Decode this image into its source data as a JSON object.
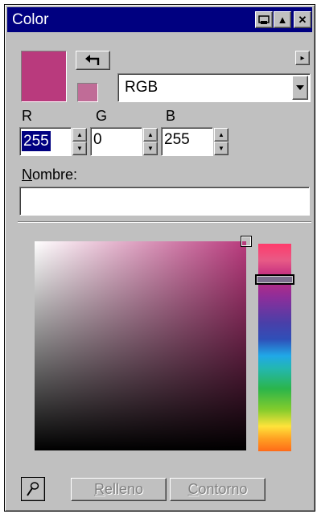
{
  "window": {
    "title": "Color",
    "btn_dock": "⊟",
    "btn_roll": "▲",
    "btn_close": "✕"
  },
  "colors": {
    "current": "#b93a7d",
    "previous": "#c06c97",
    "selection": "#000080"
  },
  "swap_icon": "↰",
  "menu_arrow": "▸",
  "model": {
    "selected": "RGB"
  },
  "channels": {
    "r": {
      "label": "R",
      "value": "255"
    },
    "g": {
      "label": "G",
      "value": "0"
    },
    "b": {
      "label": "B",
      "value": "255"
    }
  },
  "name": {
    "label_underlined": "N",
    "label_rest": "ombre:",
    "value": ""
  },
  "buttons": {
    "eyedropper_icon": "eyedropper-icon",
    "fill_underlined": "R",
    "fill_rest": "elleno",
    "outline_underlined": "C",
    "outline_rest": "ontorno"
  },
  "hue_slider_level": 0.17
}
